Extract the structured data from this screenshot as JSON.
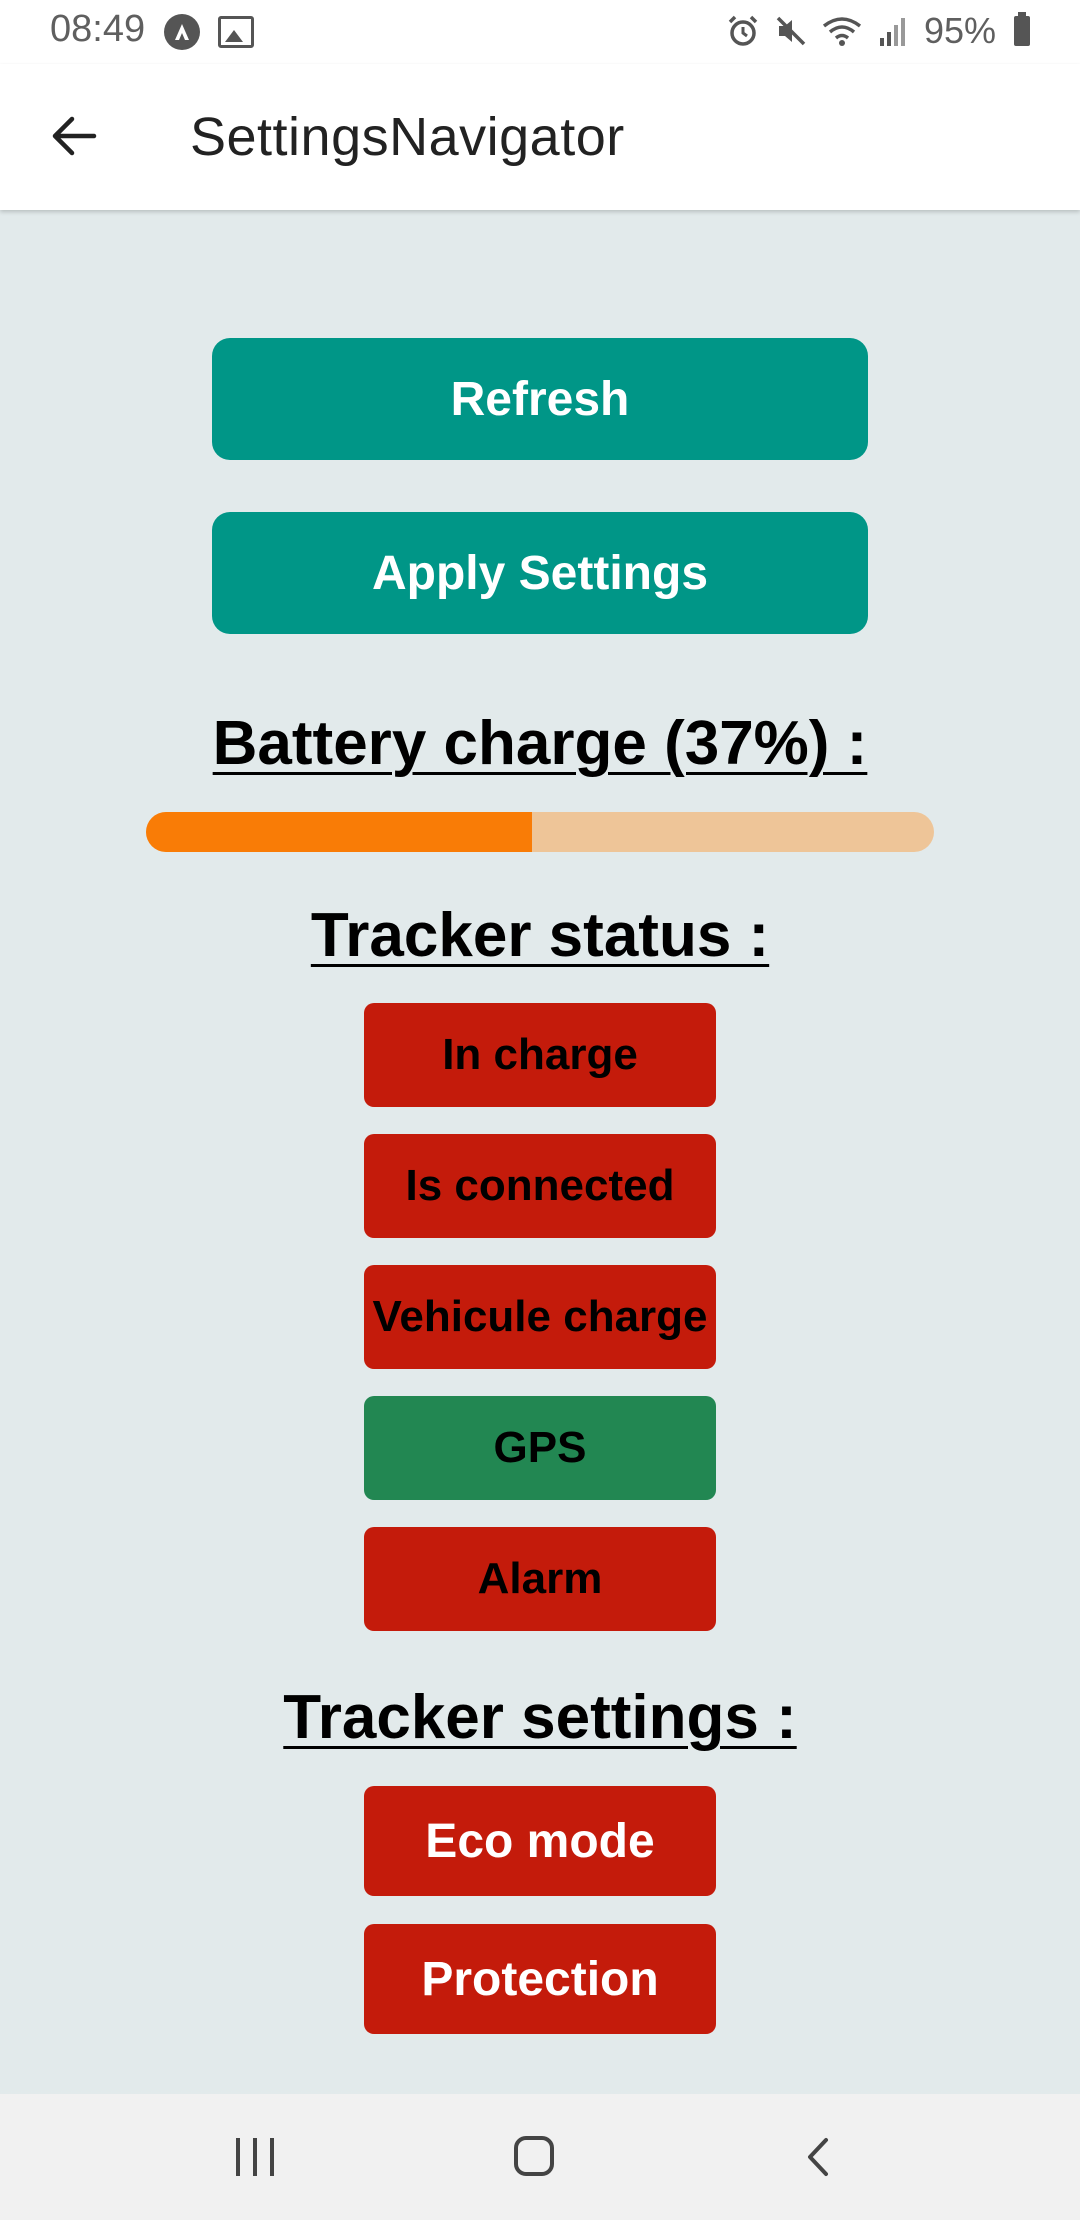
{
  "status_bar": {
    "time": "08:49",
    "battery_percent": "95%",
    "left_icons": [
      "app-notification-icon",
      "gallery-icon"
    ],
    "right_icons": [
      "alarm-icon",
      "mute-icon",
      "wifi-icon",
      "signal-icon",
      "battery-icon"
    ]
  },
  "app_bar": {
    "title": "SettingsNavigator",
    "back_icon": "back-arrow-icon"
  },
  "actions": {
    "refresh_label": "Refresh",
    "apply_label": "Apply Settings"
  },
  "battery": {
    "label": "Battery charge (37%) :",
    "bar_fill_fraction": 0.49,
    "fill_color": "#f97c06",
    "track_color": "#eec598"
  },
  "tracker_status": {
    "title": "Tracker status :",
    "items": [
      {
        "label": "In charge",
        "state": "off",
        "color": "#c41b0b"
      },
      {
        "label": "Is connected",
        "state": "off",
        "color": "#c41b0b"
      },
      {
        "label": "Vehicule charge",
        "state": "off",
        "color": "#c41b0b"
      },
      {
        "label": "GPS",
        "state": "on",
        "color": "#228752"
      },
      {
        "label": "Alarm",
        "state": "off",
        "color": "#c41b0b"
      }
    ]
  },
  "tracker_settings": {
    "title": "Tracker settings :",
    "items": [
      {
        "label": "Eco mode",
        "state": "off",
        "color": "#c41b0b"
      },
      {
        "label": "Protection",
        "state": "off",
        "color": "#c41b0b"
      }
    ]
  },
  "colors": {
    "background": "#e2eaeb",
    "primary": "#009687",
    "off": "#c41b0b",
    "on": "#228752"
  },
  "nav_bar": {
    "icons": [
      "recents-icon",
      "home-icon",
      "back-icon"
    ]
  }
}
